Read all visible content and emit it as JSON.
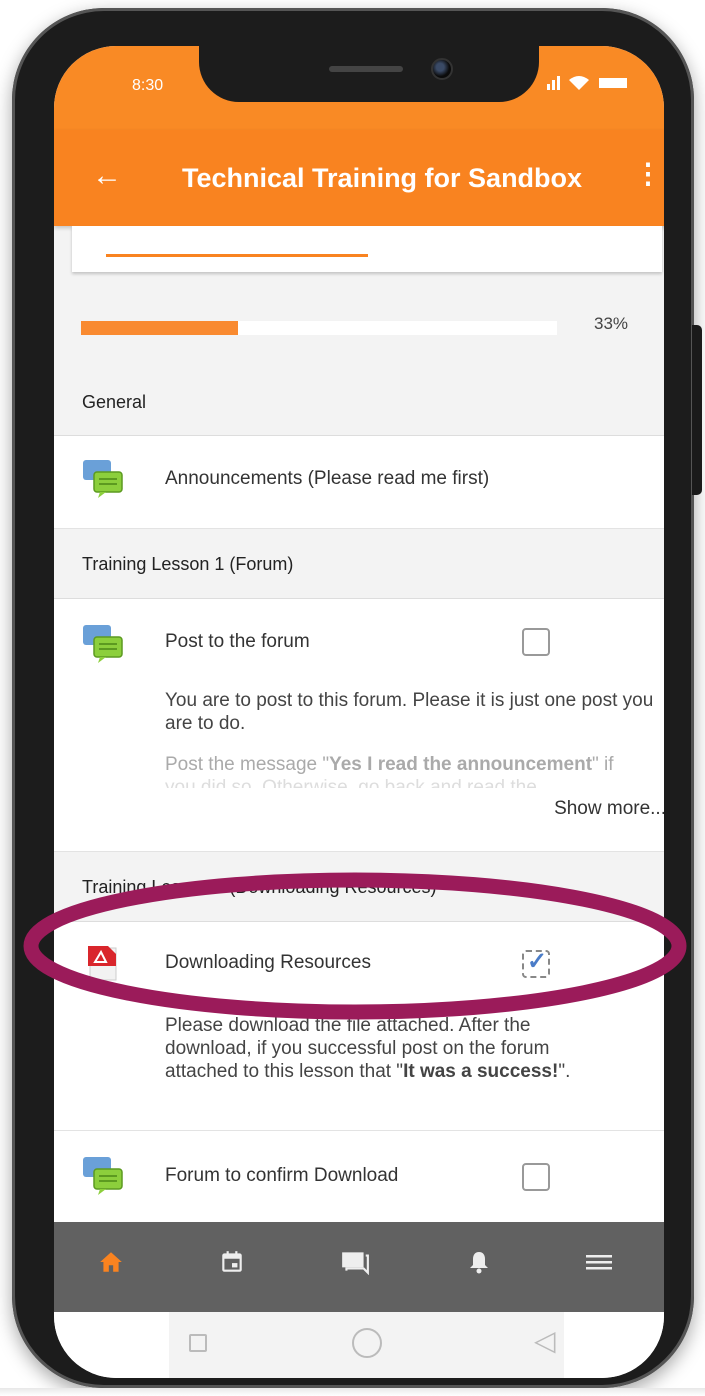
{
  "status_bar": {
    "time": "8:30",
    "signal_icons": "▂▄▆ ▼ ▬"
  },
  "app_bar": {
    "back_icon": "←",
    "title": "Technical Training for Sandbox",
    "menu_icon": "⋮"
  },
  "progress": {
    "percent_label": "33%",
    "value": 0.33
  },
  "sections": {
    "general": {
      "header": "General",
      "items": [
        {
          "title": "Announcements (Please read me first)",
          "icon": "forum-icon"
        }
      ]
    },
    "lesson1": {
      "header": "Training Lesson 1 (Forum)",
      "item": {
        "title": "Post to the forum",
        "icon": "forum-icon",
        "checked": false,
        "desc1": "You are to post to this forum. Please it is just one post you are to do.",
        "desc2_prefix": "Post the message \"",
        "desc2_bold": "Yes I read the announcement",
        "desc2_suffix": "\" if",
        "desc3": "you did so. Otherwise, go back and read the",
        "show_more": "Show more..."
      }
    },
    "lesson2": {
      "header": "Training Lesson 2 (Downloading Resources)",
      "item": {
        "title": "Downloading Resources",
        "icon": "pdf-icon",
        "checked": true,
        "desc_line1": "Please download the file attached. After the",
        "desc_line2": "download, if you successful post on the forum",
        "desc_line3_prefix": "attached to this lesson that \"",
        "desc_line3_bold": "It was a success!",
        "desc_line3_suffix": "\"."
      },
      "item2": {
        "title": "Forum to confirm Download",
        "icon": "forum-icon",
        "checked": false
      }
    }
  },
  "bottom_nav": [
    {
      "name": "home-icon",
      "glyph": "⌂"
    },
    {
      "name": "calendar-icon",
      "glyph": "▣"
    },
    {
      "name": "messages-icon",
      "glyph": "■"
    },
    {
      "name": "notifications-icon",
      "glyph": "▲"
    },
    {
      "name": "more-menu-icon",
      "glyph": "≡"
    }
  ],
  "colors": {
    "brand": "#f98320",
    "highlight": "#9b1b5a",
    "nav_bg": "#616161"
  }
}
